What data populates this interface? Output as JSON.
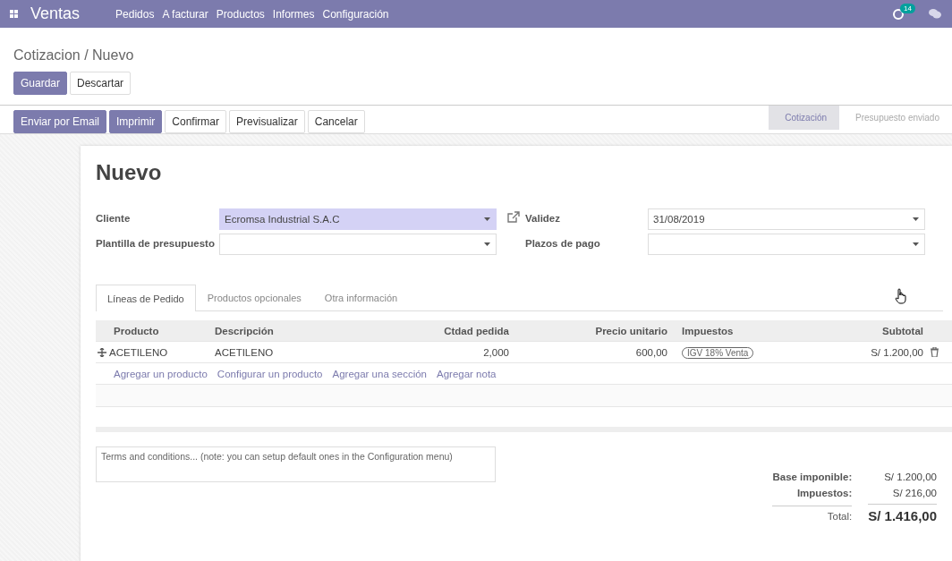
{
  "navbar": {
    "app_name": "Ventas",
    "menu": [
      "Pedidos",
      "A facturar",
      "Productos",
      "Informes",
      "Configuración"
    ],
    "activity_count": "14"
  },
  "breadcrumb": "Cotizacion / Nuevo",
  "edit_buttons": [
    {
      "label": "Guardar",
      "primary": true
    },
    {
      "label": "Descartar",
      "primary": false
    }
  ],
  "action_buttons": [
    {
      "label": "Enviar por Email",
      "primary": true
    },
    {
      "label": "Imprimir",
      "primary": true
    },
    {
      "label": "Confirmar",
      "primary": false
    },
    {
      "label": "Previsualizar",
      "primary": false
    },
    {
      "label": "Cancelar",
      "primary": false
    }
  ],
  "statusbar": [
    {
      "label": "Cotización",
      "selected": true
    },
    {
      "label": "Presupuesto enviado",
      "selected": false
    }
  ],
  "form": {
    "title": "Nuevo",
    "left_fields": [
      {
        "label": "Cliente",
        "value": "Ecromsa Industrial S.A.C",
        "highlighted": true
      },
      {
        "label": "Plantilla de presupuesto",
        "highlighted": false
      }
    ],
    "right_fields": [
      {
        "label": "Validez",
        "value": "31/08/2019",
        "highlighted": false
      },
      {
        "label": "Plazos de pago",
        "highlighted": false
      }
    ]
  },
  "tabs": [
    {
      "label": "Líneas de Pedido",
      "selected": true
    },
    {
      "label": "Productos opcionales",
      "selected": false
    },
    {
      "label": "Otra información",
      "selected": false
    }
  ],
  "table": {
    "columns": [
      "Producto",
      "Descripción",
      "Ctdad pedida",
      "Precio unitario",
      "Impuestos",
      "Subtotal"
    ],
    "rows": [
      {
        "product": "ACETILENO",
        "description": "ACETILENO",
        "quantity": "2,000",
        "unit_price": "600,00",
        "taxes": [
          "IGV 18% Venta"
        ],
        "subtotal": "S/ 1.200,00"
      }
    ],
    "add_links": [
      "Agregar un producto",
      "Configurar un producto",
      "Agregar una sección",
      "Agregar nota"
    ]
  },
  "terms": {
    "placeholder": "Terms and conditions... (note: you can setup default ones in the Configuration menu)"
  },
  "totals": [
    {
      "label": "Base imponible:",
      "value": "S/ 1.200,00",
      "kind": "line"
    },
    {
      "label": "Impuestos:",
      "value": "S/ 216,00",
      "kind": "line"
    },
    {
      "label": "Total:",
      "value": "S/ 1.416,00",
      "kind": "total"
    }
  ]
}
